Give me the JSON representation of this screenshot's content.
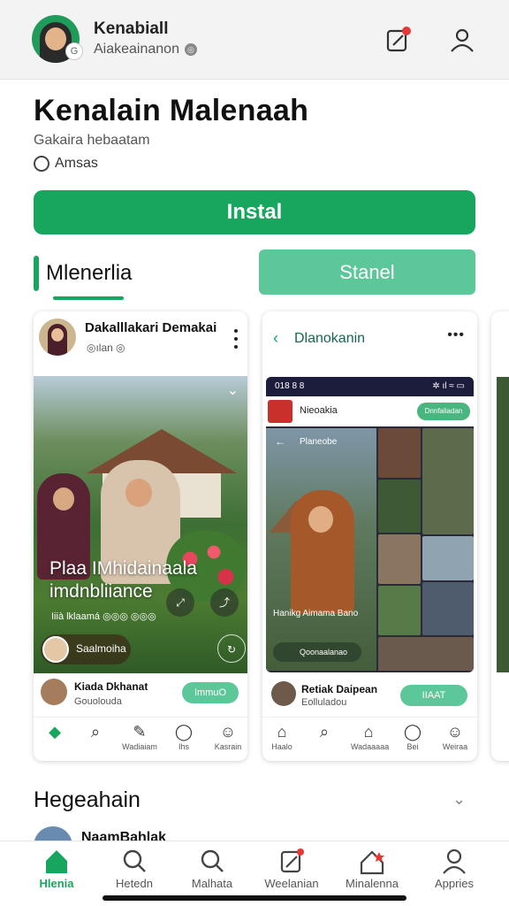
{
  "colors": {
    "accent": "#18a65e",
    "accent_light": "#5cc799",
    "bg": "#ffffff",
    "topbar": "#f3f3f3"
  },
  "topbar": {
    "title": "Kenabiall",
    "subtitle": "Aiakeainanon",
    "badge_glyph": "G",
    "icons": [
      "edit-icon",
      "user-icon"
    ]
  },
  "app": {
    "title": "Kenalain Malenaah",
    "developer": "Gakaira hebaatam",
    "rating_text": "Amsas",
    "install_label": "Instal"
  },
  "tabs": {
    "left": "Mlenerlia",
    "right": "Stanel"
  },
  "card1": {
    "name": "Dakalllakari Demakai",
    "handle": "◎ılan ◎",
    "overlay_title": "Plaa IMhidainaala imdnbliiance",
    "overlay_meta": "Iiià lklaamá ◎◎◎ ◎◎◎",
    "chip_text": "Saalmoiha",
    "footer_name": "Kiada Dkhanat",
    "footer_sub": "Gouolouda",
    "footer_button": "ImmuO",
    "nav": [
      "",
      "",
      "Wadiaiam",
      "Ihs",
      "Kasrain"
    ]
  },
  "card2": {
    "title": "Dlanokanin",
    "status_left": "018 8 8",
    "app_name": "Nieoakia",
    "app_button": "Dnnfaliadan",
    "back_label": "Planeobe",
    "caption": "Hanikg Aimama Bano",
    "chip_text": "Qoonaalanao",
    "footer_name": "Retiak Daipean",
    "footer_sub": "Eolluladou",
    "footer_button": "IIAAT",
    "nav": [
      "Haalo",
      "",
      "Wadaaaaa",
      "Bei",
      "Weiraa"
    ]
  },
  "section": {
    "title": "Hegeahain",
    "peek_name": "NaamBahlak"
  },
  "bottom_nav": [
    {
      "label": "Hlenia",
      "icon": "home-icon",
      "active": true
    },
    {
      "label": "Hetedn",
      "icon": "search-icon",
      "active": false
    },
    {
      "label": "Malhata",
      "icon": "search-icon",
      "active": false
    },
    {
      "label": "Weelanian",
      "icon": "edit-icon",
      "active": false
    },
    {
      "label": "Minalenna",
      "icon": "house-icon",
      "active": false
    },
    {
      "label": "Appries",
      "icon": "user-icon",
      "active": false
    }
  ]
}
